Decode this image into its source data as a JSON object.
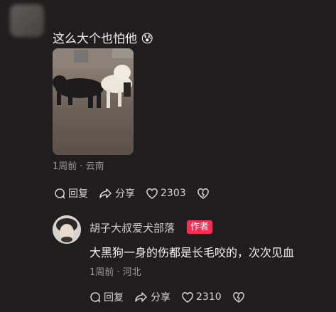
{
  "comment1": {
    "text": "这么大个也怕他 😰",
    "meta": "1周前 · 云南",
    "reply_label": "回复",
    "share_label": "分享",
    "like_count": "2303"
  },
  "comment2": {
    "author": "胡子大叔爱犬部落",
    "author_badge": "作者",
    "text": "大黑狗一身的伤都是长毛咬的，次次见血",
    "meta": "1周前 · 河北",
    "reply_label": "回复",
    "share_label": "分享",
    "like_count": "2310"
  }
}
